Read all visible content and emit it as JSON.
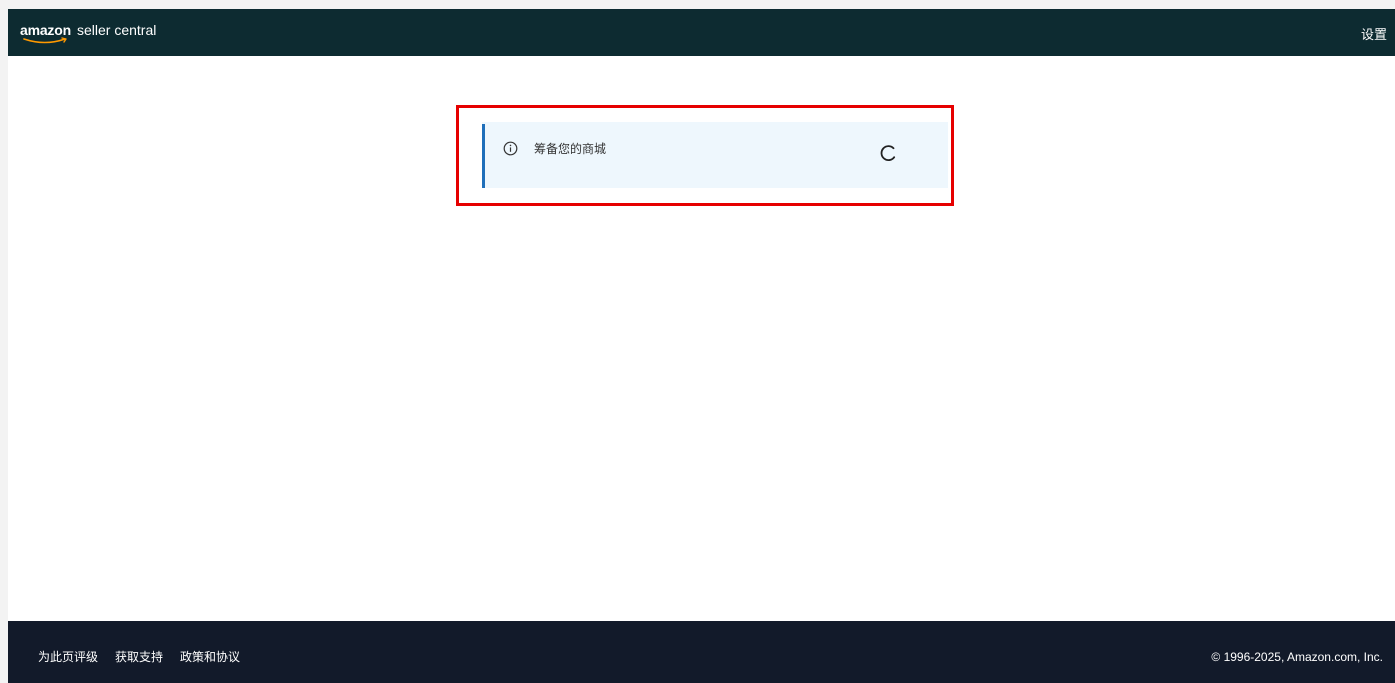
{
  "header": {
    "logo_brand": "amazon",
    "logo_product": "seller central",
    "settings_label": "设置"
  },
  "alert": {
    "message": "筹备您的商城",
    "icon": "info-icon",
    "state": "loading"
  },
  "footer": {
    "links": [
      "为此页评级",
      "获取支持",
      "政策和协议"
    ],
    "copyright": "© 1996-2025, Amazon.com, Inc."
  },
  "colors": {
    "topbar": "#0d2b31",
    "footer": "#121a2a",
    "alert_background": "#eef7fd",
    "alert_accent": "#1f6fba",
    "highlight_border": "#e60000",
    "logo_smile": "#ff9900"
  }
}
